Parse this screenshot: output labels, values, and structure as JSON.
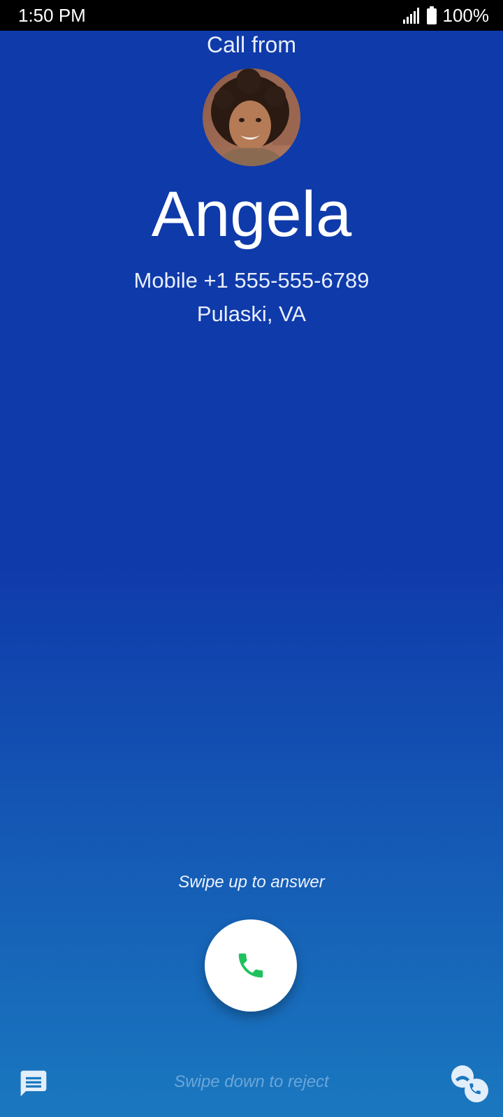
{
  "status_bar": {
    "time": "1:50 PM",
    "battery": "100%",
    "icons": [
      "signal-icon",
      "battery-icon"
    ]
  },
  "call": {
    "header": "Call from",
    "caller_name": "Angela",
    "number_line": "Mobile +1 555-555-6789",
    "location": "Pulaski, VA"
  },
  "actions": {
    "swipe_up_hint": "Swipe up to answer",
    "swipe_down_hint": "Swipe down to reject",
    "answer_icon": "phone-icon",
    "message_icon": "message-icon",
    "reject_icon": "call-reject-icon"
  },
  "colors": {
    "background_top": "#0f3aaa",
    "background_bottom": "#1a78bf",
    "answer_green": "#1fc15c",
    "hint_faded": "#6aa6d8"
  }
}
